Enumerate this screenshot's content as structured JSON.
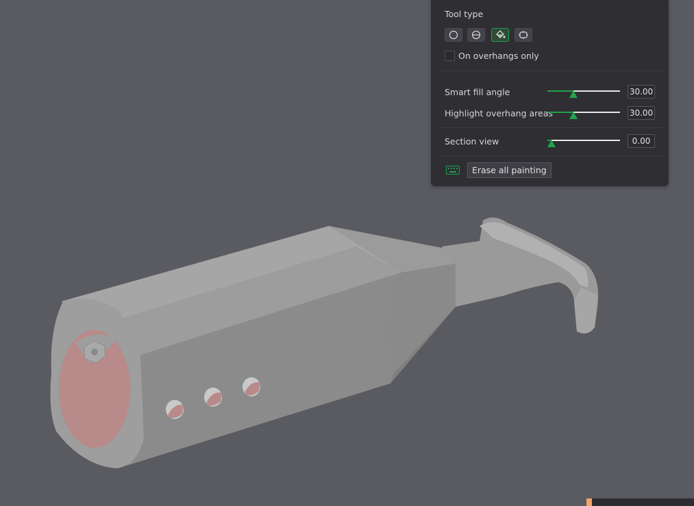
{
  "panel": {
    "tool_type_label": "Tool type",
    "tools": [
      {
        "name": "circle",
        "icon": "circle-tool-icon",
        "active": false
      },
      {
        "name": "sphere",
        "icon": "sphere-tool-icon",
        "active": false
      },
      {
        "name": "fill",
        "icon": "fill-bucket-icon",
        "active": true
      },
      {
        "name": "gap-fill",
        "icon": "gap-fill-icon",
        "active": false
      }
    ],
    "overhangs_label": "On overhangs only",
    "overhangs_checked": false,
    "smart_fill": {
      "label": "Smart fill angle",
      "value": "30.00",
      "fraction": 0.36
    },
    "highlight": {
      "label": "Highlight overhang areas",
      "value": "30.00",
      "fraction": 0.36
    },
    "section": {
      "label": "Section view",
      "value": "0.00",
      "fraction": 0.06
    },
    "erase_label": "Erase all painting",
    "keyboard_icon": "keyboard-icon"
  },
  "colors": {
    "accent": "#21a34a",
    "panel_bg": "#2e2e33",
    "viewport_bg": "#5a5a61",
    "model_gray": "#9a9a9a",
    "overhang_paint": "#b88a89"
  }
}
